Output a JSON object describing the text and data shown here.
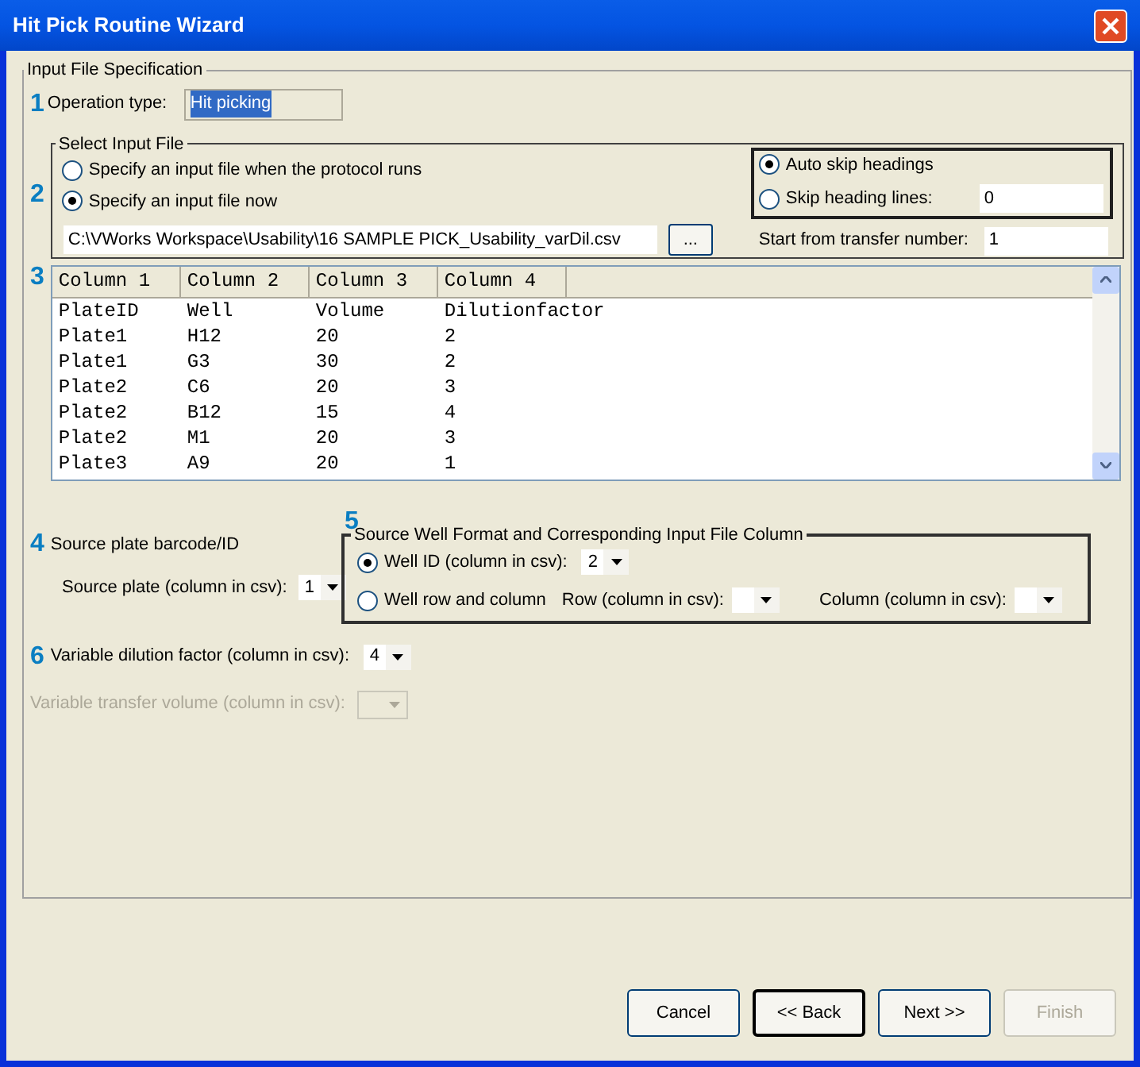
{
  "window": {
    "title": "Hit Pick Routine Wizard"
  },
  "spec": {
    "legend": "Input File Specification",
    "operation": {
      "step": "1",
      "label": "Operation type:",
      "value": "Hit picking",
      "highlighted": true
    },
    "input_file": {
      "step": "2",
      "legend": "Select Input File",
      "sources": [
        {
          "label": "Specify an input file when the protocol runs",
          "selected": false
        },
        {
          "label": "Specify an input file now",
          "selected": true
        }
      ],
      "path": "C:\\VWorks Workspace\\Usability\\16 SAMPLE PICK_Usability_varDil.csv",
      "browse": "...",
      "headings": [
        {
          "label": "Auto skip headings",
          "selected": true
        },
        {
          "label": "Skip heading lines:",
          "selected": false,
          "value": "0"
        }
      ],
      "start_label": "Start from transfer number:",
      "start_value": "1"
    },
    "preview": {
      "step": "3",
      "columns": [
        "Column 1",
        "Column 2",
        "Column 3",
        "Column 4"
      ],
      "rows": [
        [
          "PlateID",
          "Well",
          "Volume",
          "Dilutionfactor"
        ],
        [
          "Plate1",
          "H12",
          "20",
          "2"
        ],
        [
          "Plate1",
          "G3",
          "30",
          "2"
        ],
        [
          "Plate2",
          "C6",
          "20",
          "3"
        ],
        [
          "Plate2",
          "B12",
          "15",
          "4"
        ],
        [
          "Plate2",
          "M1",
          "20",
          "3"
        ],
        [
          "Plate3",
          "A9",
          "20",
          "1"
        ]
      ]
    },
    "source_plate": {
      "step": "4",
      "title": "Source plate barcode/ID",
      "label": "Source plate (column in csv):",
      "value": "1"
    },
    "source_well": {
      "step": "5",
      "legend": "Source Well Format and Corresponding Input File Column",
      "well_id": {
        "label": "Well ID (column in csv):",
        "selected": true,
        "value": "2"
      },
      "row_col": {
        "label": "Well row and column",
        "selected": false,
        "row_label": "Row (column in csv):",
        "col_label": "Column (column in csv):"
      }
    },
    "dilution": {
      "step": "6",
      "label": "Variable dilution factor (column in csv):",
      "value": "4",
      "disabled": false
    },
    "volume": {
      "label": "Variable transfer volume (column in csv):",
      "disabled": true
    }
  },
  "buttons": [
    {
      "label": "Cancel",
      "disabled": false,
      "default": false
    },
    {
      "label": "<< Back",
      "disabled": false,
      "default": true
    },
    {
      "label": "Next >>",
      "disabled": false,
      "default": false
    },
    {
      "label": "Finish",
      "disabled": true,
      "default": false
    }
  ]
}
